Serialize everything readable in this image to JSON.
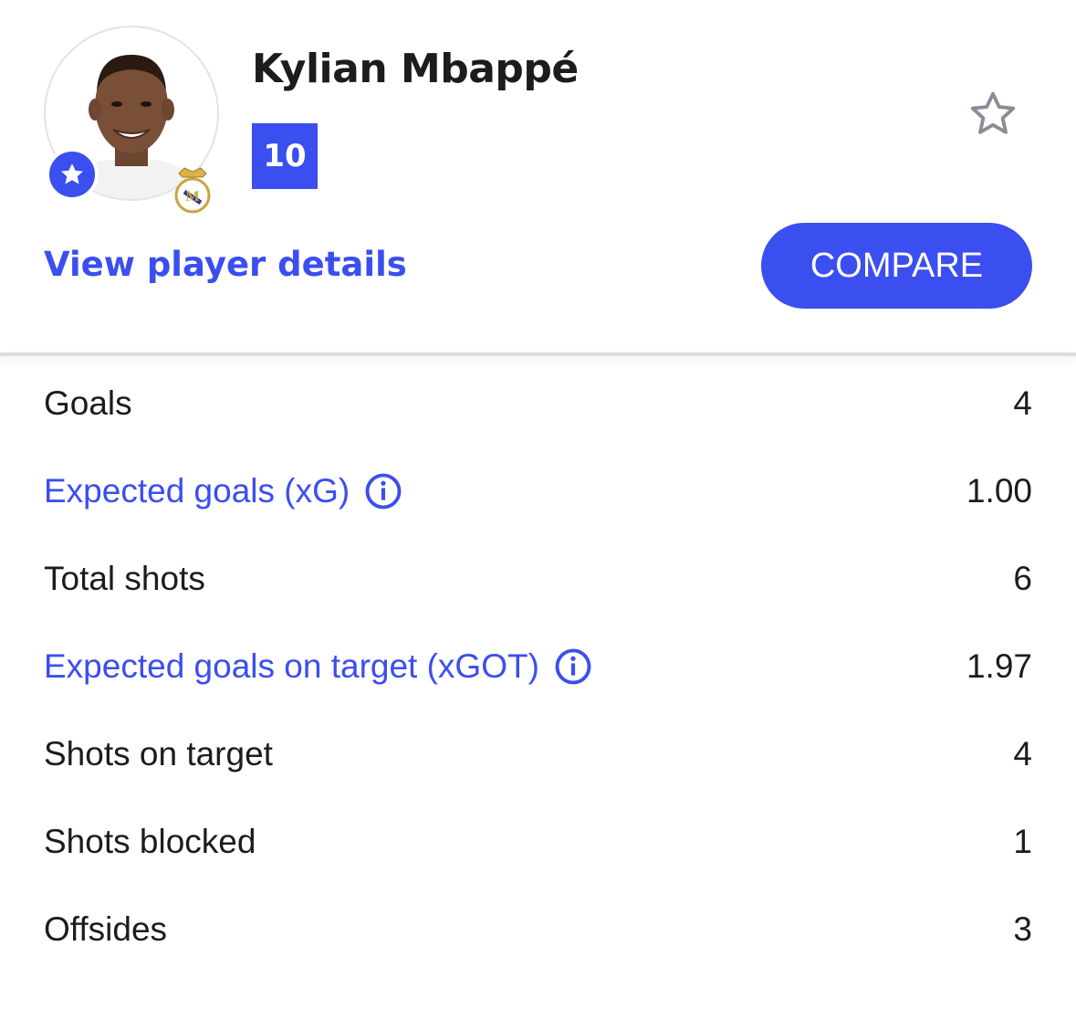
{
  "player": {
    "name": "Kylian Mbappé",
    "shirt_number": "10",
    "avatar_icon": "player-photo",
    "badge_icon": "star-icon",
    "club_icon": "club-crest-icon"
  },
  "actions": {
    "view_details": "View player details",
    "compare": "COMPARE",
    "favorite_icon": "star-outline-icon"
  },
  "colors": {
    "accent": "#3b4ef0",
    "text": "#1c1c1c",
    "muted_icon": "#8a8d96"
  },
  "stats": [
    {
      "label": "Goals",
      "value": "4",
      "link": false
    },
    {
      "label": "Expected goals (xG)",
      "value": "1.00",
      "link": true,
      "info_icon": "info-icon"
    },
    {
      "label": "Total shots",
      "value": "6",
      "link": false
    },
    {
      "label": "Expected goals on target (xGOT)",
      "value": "1.97",
      "link": true,
      "info_icon": "info-icon"
    },
    {
      "label": "Shots on target",
      "value": "4",
      "link": false
    },
    {
      "label": "Shots blocked",
      "value": "1",
      "link": false
    },
    {
      "label": "Offsides",
      "value": "3",
      "link": false
    }
  ]
}
